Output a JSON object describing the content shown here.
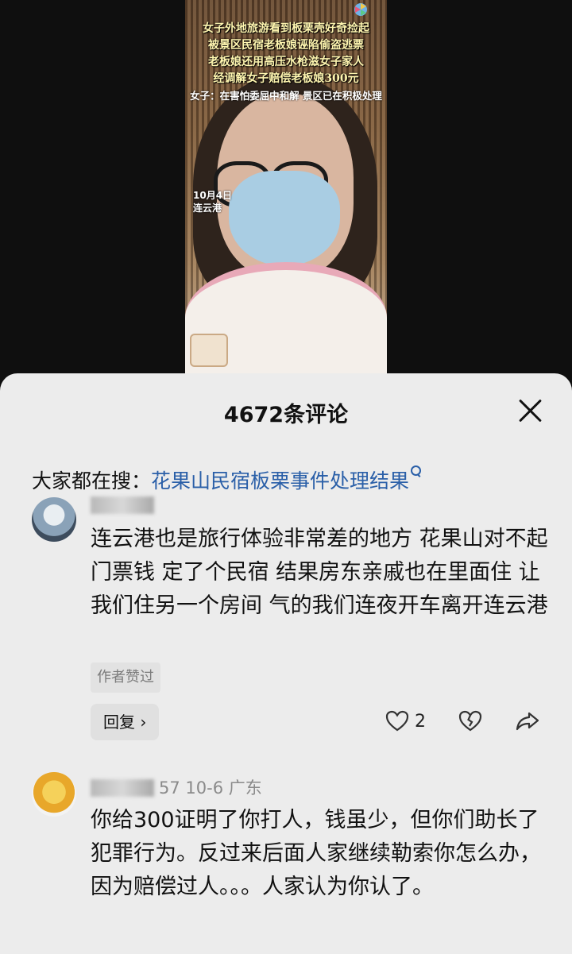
{
  "video": {
    "captions": [
      "女子外地旅游看到板栗壳好奇捡起",
      "被景区民宿老板娘诬陷偷盗逃票",
      "老板娘还用高压水枪滋女子家人",
      "经调解女子赔偿老板娘300元",
      "女子：在害怕委屈中和解 景区已在积极处理"
    ],
    "stamp_date": "10月4日",
    "stamp_place": "连云港"
  },
  "sheet": {
    "title": "4672条评论",
    "search_prefix": "大家都在搜：",
    "search_link": "花果山民宿板栗事件处理结果"
  },
  "comments": [
    {
      "meta": "",
      "text": "连云港也是旅行体验非常差的地方 花果山对不起门票钱 定了个民宿 结果房东亲戚也在里面住 让我们住另一个房间 气的我们连夜开车离开连云港",
      "tag": "作者赞过",
      "reply_label": "回复 ›",
      "likes": "2"
    },
    {
      "meta": "57  10-6  广东",
      "text": "你给300证明了你打人，钱虽少，但你们助长了犯罪行为。反过来后面人家继续勒索你怎么办，因为赔偿过人。。。人家认为你认了。"
    }
  ],
  "colors": {
    "link": "#2a5fa8",
    "sheet_bg": "#ececec"
  }
}
